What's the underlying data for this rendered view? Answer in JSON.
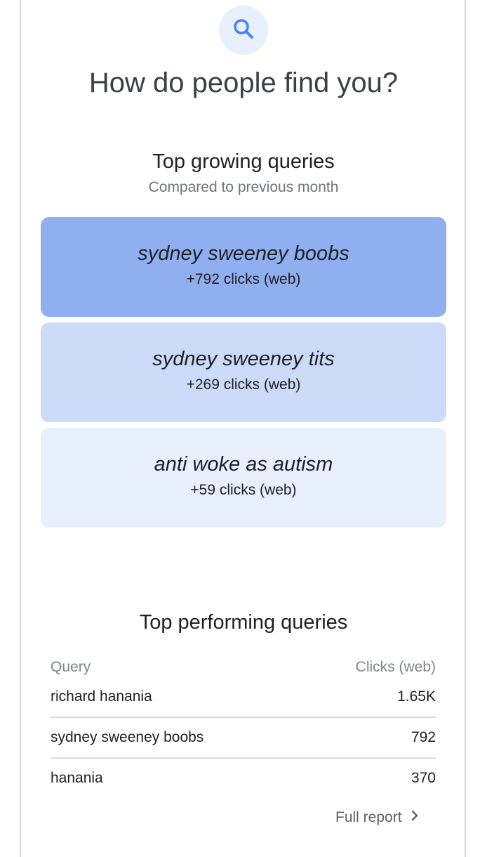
{
  "header": {
    "icon": "search-icon",
    "title": "How do people find you?"
  },
  "growing": {
    "title": "Top growing queries",
    "subtitle": "Compared to previous month",
    "items": [
      {
        "query": "sydney sweeney boobs",
        "clicks": "+792 clicks (web)",
        "color": "#8faff0"
      },
      {
        "query": "sydney sweeney tits",
        "clicks": "+269 clicks (web)",
        "color": "#cbdbf8"
      },
      {
        "query": "anti woke as autism",
        "clicks": "+59 clicks (web)",
        "color": "#e8effd"
      }
    ]
  },
  "performing": {
    "title": "Top performing queries",
    "col_query": "Query",
    "col_clicks": "Clicks (web)",
    "rows": [
      {
        "query": "richard hanania",
        "clicks": "1.65K"
      },
      {
        "query": "sydney sweeney boobs",
        "clicks": "792"
      },
      {
        "query": "hanania",
        "clicks": "370"
      }
    ],
    "full_report": "Full report"
  },
  "colors": {
    "accent": "#4285f4",
    "icon_bg": "#e8f0fe"
  }
}
